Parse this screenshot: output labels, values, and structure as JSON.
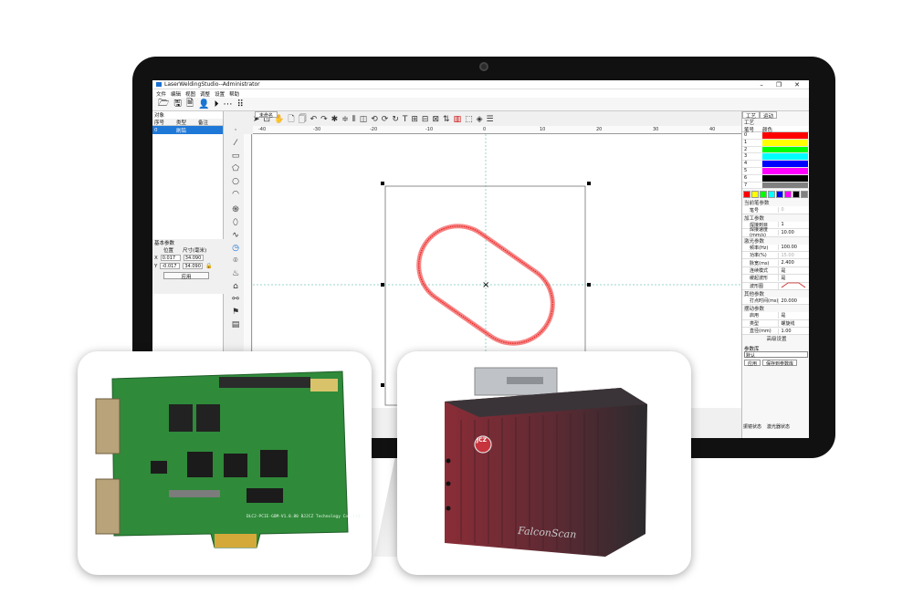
{
  "window": {
    "title": "LaserWeldingStudio--Administrator",
    "controls": [
      "–",
      "❐",
      "✕"
    ]
  },
  "menu": [
    "文件",
    "编辑",
    "视图",
    "调整",
    "设置",
    "帮助"
  ],
  "object_panel": {
    "caption": "对象",
    "headers": [
      "序号",
      "类型",
      "备注"
    ],
    "rows": [
      {
        "index": "0",
        "type": "刷铅",
        "note": ""
      }
    ]
  },
  "doc_tab": "未命名",
  "base_params": {
    "title": "基本参数",
    "col_position": "位置",
    "col_size": "尺寸(毫米)",
    "x_label": "X",
    "x_pos": "0.017",
    "x_size": "34.090",
    "y_label": "Y",
    "y_pos": "-0.017",
    "y_size": "34.090",
    "apply": "应用"
  },
  "ruler": {
    "ticks": [
      "-40",
      "-30",
      "-20",
      "-10",
      "0",
      "10",
      "20",
      "30",
      "40"
    ]
  },
  "right_panel": {
    "tabs": [
      "工艺",
      "运动"
    ],
    "caption": "工艺",
    "color_table": {
      "header_num": "笔号",
      "header_color": "颜色",
      "rows": [
        {
          "num": "0",
          "color": "#ff0000"
        },
        {
          "num": "1",
          "color": "#ffff00"
        },
        {
          "num": "2",
          "color": "#00ff00"
        },
        {
          "num": "3",
          "color": "#00ffff"
        },
        {
          "num": "4",
          "color": "#0000ff"
        },
        {
          "num": "5",
          "color": "#ff00ff"
        },
        {
          "num": "6",
          "color": "#000000"
        },
        {
          "num": "7",
          "color": "#808080"
        }
      ]
    },
    "palette": [
      "#ff0000",
      "#ffff00",
      "#00ff00",
      "#00ffff",
      "#0000ff",
      "#ff00ff",
      "#000000",
      "#808080"
    ],
    "sections": {
      "current_pen": "当前笔参数",
      "pen_no_label": "笔号",
      "pen_no_value": "0",
      "process": "加工参数",
      "weld_count_label": "焊接到目",
      "weld_count_value": "1",
      "weld_speed_label": "焊接速度(mm/s)",
      "weld_speed_value": "10.00",
      "laser": "激光参数",
      "freq_label": "频率(Hz)",
      "freq_value": "100.00",
      "power_label": "功率(%)",
      "power_value": "15.00",
      "pulse_label": "脉宽(ms)",
      "pulse_value": "2.400",
      "cont_label": "连续模式",
      "cont_value": "是",
      "slow_label": "缓起波形",
      "slow_value": "是",
      "wave_label": "波形图",
      "other": "其他参数",
      "spot_label": "打点时间(ms)",
      "spot_value": "20.000",
      "wobble": "摆动参数",
      "enable_label": "启用",
      "enable_value": "是",
      "type_label": "类型",
      "type_value": "螺旋线",
      "radius_label": "直径(mm)",
      "radius_value": "1.00"
    },
    "advanced": "高级设置",
    "library": {
      "title": "参数库",
      "selected": "默认",
      "apply": "应用",
      "save": "保存到参数库"
    },
    "status": [
      "振镜状态",
      "激光器状态"
    ]
  },
  "photos": {
    "pcb_label": "DLC2-PCIE-GOM-V1.0.80 BJJCZ Technology Co.,Ltd",
    "scanner_label": "FalconScan",
    "scanner_logo": "JCZ"
  }
}
